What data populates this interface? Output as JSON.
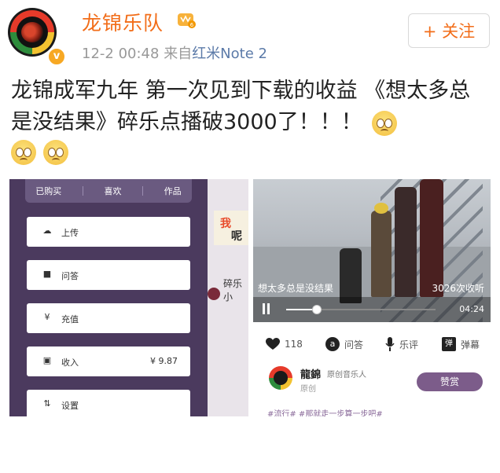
{
  "post": {
    "author": "龙锦乐队",
    "time": "12-2 00:48",
    "source_prefix": "来自",
    "source_device": "红米Note 2",
    "follow_label": "+ 关注",
    "verified_badge": "v",
    "text": "龙锦成军九年  第一次见到下载的收益  《想太多总是没结果》碎乐点播破3000了！！！"
  },
  "left_shot": {
    "tabs": [
      "已购买",
      "喜欢",
      "作品"
    ],
    "menu": [
      {
        "icon": "cloud-icon",
        "label": "上传",
        "value": ""
      },
      {
        "icon": "chat-icon",
        "label": "问答",
        "value": ""
      },
      {
        "icon": "yen-icon",
        "label": "充值",
        "value": ""
      },
      {
        "icon": "wallet-icon",
        "label": "收入",
        "value": "¥ 9.87"
      },
      {
        "icon": "settings-icon",
        "label": "设置",
        "value": ""
      }
    ]
  },
  "middle_strip": {
    "card_text_1": "我",
    "card_text_2": "呢",
    "item_text": "碎乐小"
  },
  "right_shot": {
    "video_title": "想太多总是没结果",
    "plays": "3026次收听",
    "duration": "04:24",
    "progress": 0.2,
    "actions": [
      {
        "icon": "heart-icon",
        "label": "118"
      },
      {
        "icon": "qa-icon",
        "label": "问答"
      },
      {
        "icon": "mic-icon",
        "label": "乐评"
      },
      {
        "icon": "danmaku-icon",
        "label": "弹幕"
      }
    ],
    "user_name": "龍錦",
    "user_role": "原创音乐人",
    "user_sub": "原创",
    "tip_label": "赞赏",
    "tags": "#流行#  #那就走一步算一步吧#"
  }
}
